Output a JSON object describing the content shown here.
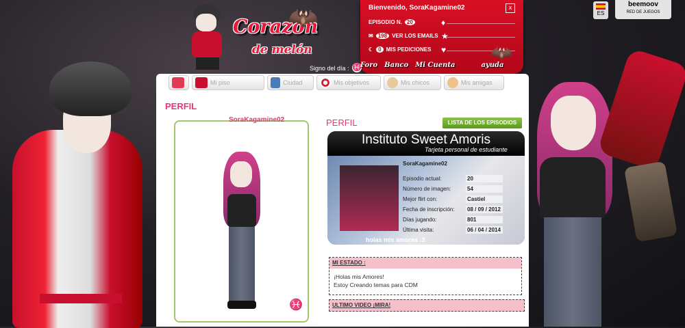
{
  "header": {
    "logo_title": "Corazón",
    "logo_subtitle": "de melón",
    "welcome": "Bienvenido, SoraKagamine02",
    "close_label": "x",
    "episode_label": "EPISODIO N.",
    "episode_num": "20",
    "row2_label": "VER LOS EMAILS",
    "row2_count": "198",
    "row3_label": "MIS PEDICIONES",
    "row3_count": "0",
    "sign_label": "Signo del día :",
    "sign_symbol": "♓",
    "menu": [
      "Foro",
      "Banco",
      "Mi Cuenta",
      "ayuda"
    ],
    "lang_label": "ES",
    "beemoov_label": "beemoov",
    "beemoov_sub": "RED DE JUEGOS"
  },
  "tabs": [
    {
      "label": "",
      "icon": "home-icon",
      "color": "#e23a55"
    },
    {
      "label": "Mi piso",
      "icon": "sofa-icon",
      "color": "#c8102e"
    },
    {
      "label": "Ciudad",
      "icon": "building-icon",
      "color": "#4a7ab8"
    },
    {
      "label": "Mis objetivos",
      "icon": "target-icon",
      "color": "#d02030"
    },
    {
      "label": "Mis chicos",
      "icon": "boy-icon",
      "color": "#e7c9a0"
    },
    {
      "label": "Mis amigas",
      "icon": "girl-icon",
      "color": "#f0c18a"
    }
  ],
  "profile": {
    "heading": "PERFIL",
    "username": "SoraKagamine02",
    "heading2": "PERFIL",
    "episodes_button": "LISTA DE LOS EPISODIOS",
    "card_title": "Instituto Sweet Amoris",
    "card_subtitle": "Tarjeta personal de estudiante",
    "card_name": "SoraKagamine02",
    "fields": [
      {
        "label": "Episodio actual:",
        "value": "20"
      },
      {
        "label": "Número de imagen:",
        "value": "54"
      },
      {
        "label": "Mejor flirt con:",
        "value": "Castiel"
      },
      {
        "label": "Fecha de inscripción:",
        "value": "08 / 09 / 2012"
      },
      {
        "label": "Días jugando:",
        "value": "801"
      },
      {
        "label": "Última visita:",
        "value": "06 / 04 / 2014"
      }
    ],
    "status_text": "holas mis amores :3",
    "estado_heading": "MI ESTADO :",
    "estado_lines": [
      "¡Holas mis Amores!",
      "Estoy Creando temas para CDM"
    ],
    "video_heading": "ULTIMO VIDEO ¡MIRA!"
  },
  "colors": {
    "accent_pink": "#e8347a",
    "hud_red": "#d80f24",
    "button_green": "#6aab2a"
  }
}
